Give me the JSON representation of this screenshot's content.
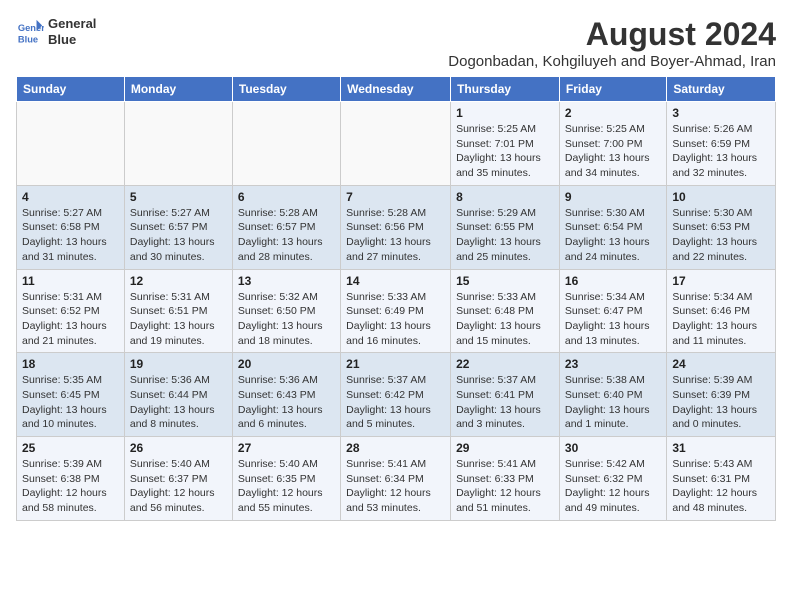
{
  "header": {
    "logo_line1": "General",
    "logo_line2": "Blue",
    "title": "August 2024",
    "subtitle": "Dogonbadan, Kohgiluyeh and Boyer-Ahmad, Iran"
  },
  "days_of_week": [
    "Sunday",
    "Monday",
    "Tuesday",
    "Wednesday",
    "Thursday",
    "Friday",
    "Saturday"
  ],
  "weeks": [
    [
      {
        "day": "",
        "info": ""
      },
      {
        "day": "",
        "info": ""
      },
      {
        "day": "",
        "info": ""
      },
      {
        "day": "",
        "info": ""
      },
      {
        "day": "1",
        "info": "Sunrise: 5:25 AM\nSunset: 7:01 PM\nDaylight: 13 hours\nand 35 minutes."
      },
      {
        "day": "2",
        "info": "Sunrise: 5:25 AM\nSunset: 7:00 PM\nDaylight: 13 hours\nand 34 minutes."
      },
      {
        "day": "3",
        "info": "Sunrise: 5:26 AM\nSunset: 6:59 PM\nDaylight: 13 hours\nand 32 minutes."
      }
    ],
    [
      {
        "day": "4",
        "info": "Sunrise: 5:27 AM\nSunset: 6:58 PM\nDaylight: 13 hours\nand 31 minutes."
      },
      {
        "day": "5",
        "info": "Sunrise: 5:27 AM\nSunset: 6:57 PM\nDaylight: 13 hours\nand 30 minutes."
      },
      {
        "day": "6",
        "info": "Sunrise: 5:28 AM\nSunset: 6:57 PM\nDaylight: 13 hours\nand 28 minutes."
      },
      {
        "day": "7",
        "info": "Sunrise: 5:28 AM\nSunset: 6:56 PM\nDaylight: 13 hours\nand 27 minutes."
      },
      {
        "day": "8",
        "info": "Sunrise: 5:29 AM\nSunset: 6:55 PM\nDaylight: 13 hours\nand 25 minutes."
      },
      {
        "day": "9",
        "info": "Sunrise: 5:30 AM\nSunset: 6:54 PM\nDaylight: 13 hours\nand 24 minutes."
      },
      {
        "day": "10",
        "info": "Sunrise: 5:30 AM\nSunset: 6:53 PM\nDaylight: 13 hours\nand 22 minutes."
      }
    ],
    [
      {
        "day": "11",
        "info": "Sunrise: 5:31 AM\nSunset: 6:52 PM\nDaylight: 13 hours\nand 21 minutes."
      },
      {
        "day": "12",
        "info": "Sunrise: 5:31 AM\nSunset: 6:51 PM\nDaylight: 13 hours\nand 19 minutes."
      },
      {
        "day": "13",
        "info": "Sunrise: 5:32 AM\nSunset: 6:50 PM\nDaylight: 13 hours\nand 18 minutes."
      },
      {
        "day": "14",
        "info": "Sunrise: 5:33 AM\nSunset: 6:49 PM\nDaylight: 13 hours\nand 16 minutes."
      },
      {
        "day": "15",
        "info": "Sunrise: 5:33 AM\nSunset: 6:48 PM\nDaylight: 13 hours\nand 15 minutes."
      },
      {
        "day": "16",
        "info": "Sunrise: 5:34 AM\nSunset: 6:47 PM\nDaylight: 13 hours\nand 13 minutes."
      },
      {
        "day": "17",
        "info": "Sunrise: 5:34 AM\nSunset: 6:46 PM\nDaylight: 13 hours\nand 11 minutes."
      }
    ],
    [
      {
        "day": "18",
        "info": "Sunrise: 5:35 AM\nSunset: 6:45 PM\nDaylight: 13 hours\nand 10 minutes."
      },
      {
        "day": "19",
        "info": "Sunrise: 5:36 AM\nSunset: 6:44 PM\nDaylight: 13 hours\nand 8 minutes."
      },
      {
        "day": "20",
        "info": "Sunrise: 5:36 AM\nSunset: 6:43 PM\nDaylight: 13 hours\nand 6 minutes."
      },
      {
        "day": "21",
        "info": "Sunrise: 5:37 AM\nSunset: 6:42 PM\nDaylight: 13 hours\nand 5 minutes."
      },
      {
        "day": "22",
        "info": "Sunrise: 5:37 AM\nSunset: 6:41 PM\nDaylight: 13 hours\nand 3 minutes."
      },
      {
        "day": "23",
        "info": "Sunrise: 5:38 AM\nSunset: 6:40 PM\nDaylight: 13 hours\nand 1 minute."
      },
      {
        "day": "24",
        "info": "Sunrise: 5:39 AM\nSunset: 6:39 PM\nDaylight: 13 hours\nand 0 minutes."
      }
    ],
    [
      {
        "day": "25",
        "info": "Sunrise: 5:39 AM\nSunset: 6:38 PM\nDaylight: 12 hours\nand 58 minutes."
      },
      {
        "day": "26",
        "info": "Sunrise: 5:40 AM\nSunset: 6:37 PM\nDaylight: 12 hours\nand 56 minutes."
      },
      {
        "day": "27",
        "info": "Sunrise: 5:40 AM\nSunset: 6:35 PM\nDaylight: 12 hours\nand 55 minutes."
      },
      {
        "day": "28",
        "info": "Sunrise: 5:41 AM\nSunset: 6:34 PM\nDaylight: 12 hours\nand 53 minutes."
      },
      {
        "day": "29",
        "info": "Sunrise: 5:41 AM\nSunset: 6:33 PM\nDaylight: 12 hours\nand 51 minutes."
      },
      {
        "day": "30",
        "info": "Sunrise: 5:42 AM\nSunset: 6:32 PM\nDaylight: 12 hours\nand 49 minutes."
      },
      {
        "day": "31",
        "info": "Sunrise: 5:43 AM\nSunset: 6:31 PM\nDaylight: 12 hours\nand 48 minutes."
      }
    ]
  ]
}
